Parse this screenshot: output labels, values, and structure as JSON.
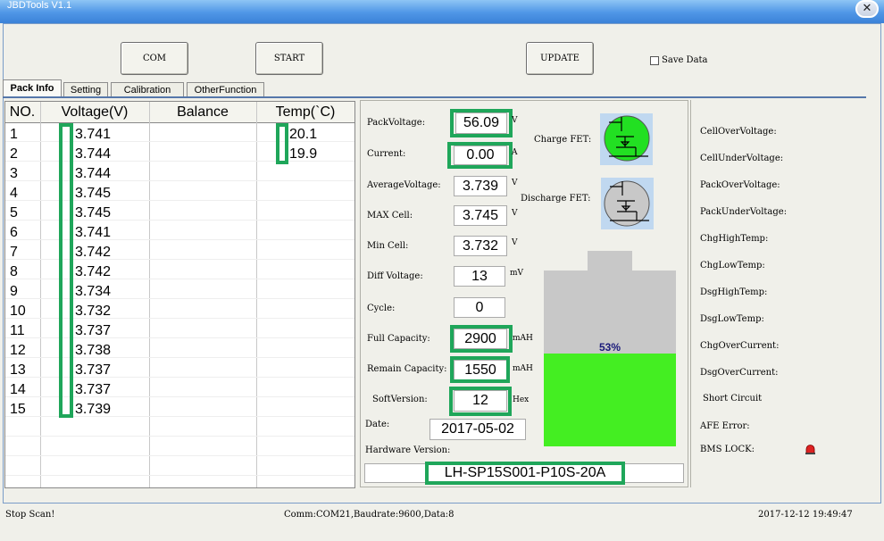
{
  "window": {
    "title": "JBDTools V1.1",
    "close_glyph": "✕"
  },
  "toolbar": {
    "com_label": "COM",
    "start_label": "START",
    "update_label": "UPDATE",
    "save_data_label": "Save Data"
  },
  "tabs": [
    {
      "label": "Pack Info"
    },
    {
      "label": "Setting"
    },
    {
      "label": "Calibration"
    },
    {
      "label": "OtherFunction"
    }
  ],
  "cell_table": {
    "headers": [
      "NO.",
      "Voltage(V)",
      "Balance",
      "Temp(`C)"
    ],
    "rows": [
      {
        "no": "1",
        "voltage": "3.741",
        "temp": "20.1"
      },
      {
        "no": "2",
        "voltage": "3.744",
        "temp": "19.9"
      },
      {
        "no": "3",
        "voltage": "3.744"
      },
      {
        "no": "4",
        "voltage": "3.745"
      },
      {
        "no": "5",
        "voltage": "3.745"
      },
      {
        "no": "6",
        "voltage": "3.741"
      },
      {
        "no": "7",
        "voltage": "3.742"
      },
      {
        "no": "8",
        "voltage": "3.742"
      },
      {
        "no": "9",
        "voltage": "3.734"
      },
      {
        "no": "10",
        "voltage": "3.732"
      },
      {
        "no": "11",
        "voltage": "3.737"
      },
      {
        "no": "12",
        "voltage": "3.738"
      },
      {
        "no": "13",
        "voltage": "3.737"
      },
      {
        "no": "14",
        "voltage": "3.737"
      },
      {
        "no": "15",
        "voltage": "3.739"
      }
    ]
  },
  "pack": {
    "pack_voltage": {
      "label": "PackVoltage:",
      "value": "56.09",
      "unit": "V"
    },
    "current": {
      "label": "Current:",
      "value": "0.00",
      "unit": "A"
    },
    "average_voltage": {
      "label": "AverageVoltage:",
      "value": "3.739",
      "unit": "V"
    },
    "max_cell": {
      "label": "MAX Cell:",
      "value": "3.745",
      "unit": "V"
    },
    "min_cell": {
      "label": "Min Cell:",
      "value": "3.732",
      "unit": "V"
    },
    "diff_voltage": {
      "label": "Diff Voltage:",
      "value": "13",
      "unit": "mV"
    },
    "cycle": {
      "label": "Cycle:",
      "value": "0"
    },
    "full_capacity": {
      "label": "Full Capacity:",
      "value": "2900",
      "unit": "mAH"
    },
    "remain_capacity": {
      "label": "Remain Capacity:",
      "value": "1550",
      "unit": "mAH"
    },
    "soft_version": {
      "label": "SoftVersion:",
      "value": "12",
      "unit": "Hex"
    },
    "date": {
      "label": "Date:",
      "value": "2017-05-02"
    },
    "hardware_version": {
      "label": "Hardware Version:",
      "value": "LH-SP15S001-P10S-20A"
    }
  },
  "fets": {
    "charge": {
      "label": "Charge FET:",
      "state_color": "#22e022"
    },
    "discharge": {
      "label": "Discharge FET:",
      "state_color": "#c8c8c8"
    }
  },
  "battery": {
    "percent_text": "53%",
    "level": 0.53,
    "fill_color": "#44ee22",
    "empty_color": "#c8c8c8"
  },
  "protection": {
    "items": [
      "CellOverVoltage:",
      "CellUnderVoltage:",
      "PackOverVoltage:",
      "PackUnderVoltage:",
      "ChgHighTemp:",
      "ChgLowTemp:",
      "DsgHighTemp:",
      "DsgLowTemp:",
      "ChgOverCurrent:",
      "DsgOverCurrent:",
      "Short Circuit",
      "AFE Error:",
      "BMS LOCK:"
    ],
    "alarm_icon_color": "#dd2222"
  },
  "statusbar": {
    "left": "Stop Scan!",
    "middle": "Comm:COM21,Baudrate:9600,Data:8",
    "right": "2017-12-12 19:49:47"
  },
  "accent_colors": {
    "highlight_box": "#1fa65a",
    "titlebar": "#4f96e6"
  }
}
